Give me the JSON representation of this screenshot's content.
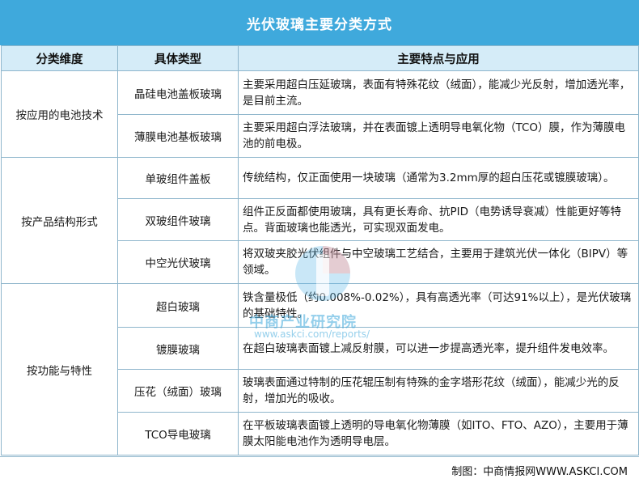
{
  "title": "光伏玻璃主要分类方式",
  "headers": [
    "分类维度",
    "具体类型",
    "主要特点与应用"
  ],
  "groups": [
    {
      "dimension": "按应用的电池技术",
      "rows": [
        {
          "type": "晶硅电池盖板玻璃",
          "desc": "主要采用超白压延玻璃，表面有特殊花纹（绒面），能减少光反射，增加透光率，是目前主流。"
        },
        {
          "type": "薄膜电池基板玻璃",
          "desc": "主要采用超白浮法玻璃，并在表面镀上透明导电氧化物（TCO）膜，作为薄膜电池的前电极。"
        }
      ]
    },
    {
      "dimension": "按产品结构形式",
      "rows": [
        {
          "type": "单玻组件盖板",
          "desc": "传统结构，仅正面使用一块玻璃（通常为3.2mm厚的超白压花或镀膜玻璃）。"
        },
        {
          "type": "双玻组件玻璃",
          "desc": "组件正反面都使用玻璃，具有更长寿命、抗PID（电势诱导衰减）性能更好等特点。背面玻璃也能透光，可实现双面发电。"
        },
        {
          "type": "中空光伏玻璃",
          "desc": "将双玻夹胶光伏组件与中空玻璃工艺结合，主要用于建筑光伏一体化（BIPV）等领域。"
        }
      ]
    },
    {
      "dimension": "按功能与特性",
      "rows": [
        {
          "type": "超白玻璃",
          "desc": "铁含量极低（约0.008%-0.02%），具有高透光率（可达91%以上），是光伏玻璃的基础特性。"
        },
        {
          "type": "镀膜玻璃",
          "desc": "在超白玻璃表面镀上减反射膜，可以进一步提高透光率，提升组件发电效率。"
        },
        {
          "type": "压花（绒面）玻璃",
          "desc": "玻璃表面通过特制的压花辊压制有特殊的金字塔形花纹（绒面），能减少光的反射，增加光的吸收。"
        },
        {
          "type": "TCO导电玻璃",
          "desc": "在平板玻璃表面镀上透明的导电氧化物薄膜（如ITO、FTO、AZO），主要用于薄膜太阳能电池作为透明导电层。"
        }
      ]
    }
  ],
  "footer": "制图：中商情报网WWW.ASKCI.COM",
  "watermark": {
    "name": "中商产业研究院",
    "url": "www.askci.com/reports/"
  },
  "colors": {
    "title_bg": "#3fa9dc",
    "header_bg": "#d5ecf8",
    "border": "#8fb6cc"
  }
}
